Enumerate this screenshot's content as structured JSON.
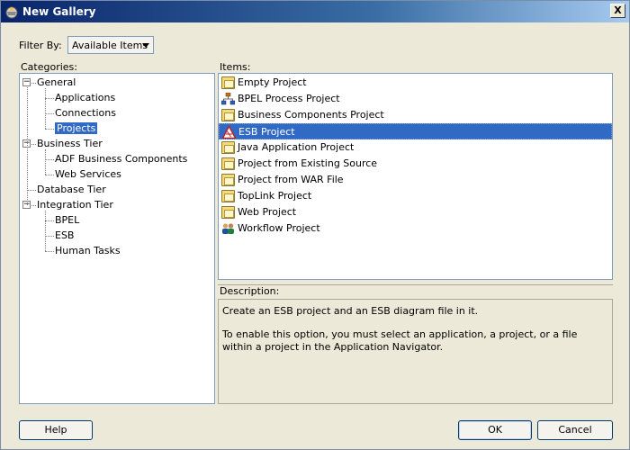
{
  "window": {
    "title": "New Gallery",
    "close_label": "X"
  },
  "filter": {
    "label": "Filter By:",
    "selected": "Available Items"
  },
  "categories": {
    "label": "Categories:",
    "tree": [
      {
        "label": "General",
        "level": 0,
        "expanded": true
      },
      {
        "label": "Applications",
        "level": 1
      },
      {
        "label": "Connections",
        "level": 1
      },
      {
        "label": "Projects",
        "level": 1,
        "selected": true
      },
      {
        "label": "Business Tier",
        "level": 0,
        "expanded": true
      },
      {
        "label": "ADF Business Components",
        "level": 1
      },
      {
        "label": "Web Services",
        "level": 1
      },
      {
        "label": "Database Tier",
        "level": 0
      },
      {
        "label": "Integration Tier",
        "level": 0,
        "expanded": true
      },
      {
        "label": "BPEL",
        "level": 1
      },
      {
        "label": "ESB",
        "level": 1
      },
      {
        "label": "Human Tasks",
        "level": 1
      }
    ]
  },
  "items": {
    "label": "Items:",
    "list": [
      {
        "label": "Empty Project",
        "icon": "folder-icon"
      },
      {
        "label": "BPEL Process Project",
        "icon": "bpel-icon"
      },
      {
        "label": "Business Components Project",
        "icon": "folder-icon"
      },
      {
        "label": "ESB Project",
        "icon": "esb-icon",
        "selected": true
      },
      {
        "label": "Java Application Project",
        "icon": "folder-icon"
      },
      {
        "label": "Project from Existing Source",
        "icon": "folder-icon"
      },
      {
        "label": "Project from WAR File",
        "icon": "folder-icon"
      },
      {
        "label": "TopLink Project",
        "icon": "folder-icon"
      },
      {
        "label": "Web Project",
        "icon": "folder-icon"
      },
      {
        "label": "Workflow Project",
        "icon": "workflow-icon"
      }
    ]
  },
  "description": {
    "label": "Description:",
    "line1": "Create an ESB project and an ESB diagram file in it.",
    "line2": "To enable this option, you must select an application, a project, or a file within a project in the Application Navigator."
  },
  "buttons": {
    "help": "Help",
    "ok": "OK",
    "cancel": "Cancel"
  },
  "colors": {
    "selection": "#316ac5",
    "title_gradient_start": "#0a246a",
    "dialog_bg": "#ece9d8"
  }
}
